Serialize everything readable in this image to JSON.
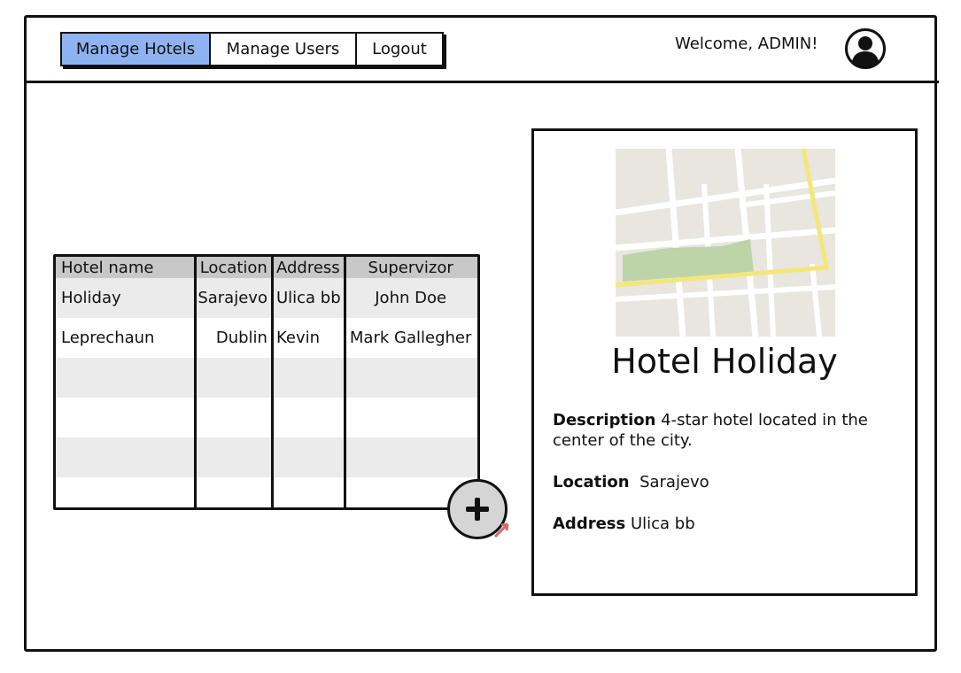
{
  "nav": {
    "items": [
      {
        "label": "Manage Hotels",
        "active": true
      },
      {
        "label": "Manage Users",
        "active": false
      },
      {
        "label": "Logout",
        "active": false
      }
    ]
  },
  "header": {
    "welcome": "Welcome, ADMIN!"
  },
  "table": {
    "columns": [
      "Hotel name",
      "Location",
      "Address",
      "Supervizor"
    ],
    "rows": [
      [
        "Holiday",
        "Sarajevo",
        "Ulica bb",
        "John Doe"
      ],
      [
        "Leprechaun",
        "Dublin",
        "Kevin",
        "Mark Gallegher"
      ],
      [
        "",
        "",
        "",
        ""
      ],
      [
        "",
        "",
        "",
        ""
      ],
      [
        "",
        "",
        "",
        ""
      ],
      [
        "",
        "",
        "",
        ""
      ]
    ]
  },
  "details": {
    "title": "Hotel Holiday",
    "description_label": "Description",
    "description_value": "4-star hotel located in the center of the city.",
    "location_label": "Location",
    "location_value": "Sarajevo",
    "address_label": "Address",
    "address_value": "Ulica bb"
  },
  "icons": {
    "avatar": "user-avatar-icon",
    "add": "plus-icon",
    "map": "map-image"
  },
  "colors": {
    "active_nav": "#8fb3f0",
    "table_header": "#c8c8c8",
    "row_alt": "#ebebeb",
    "map_park": "#bcd4a8",
    "map_road": "#f4e77a"
  }
}
